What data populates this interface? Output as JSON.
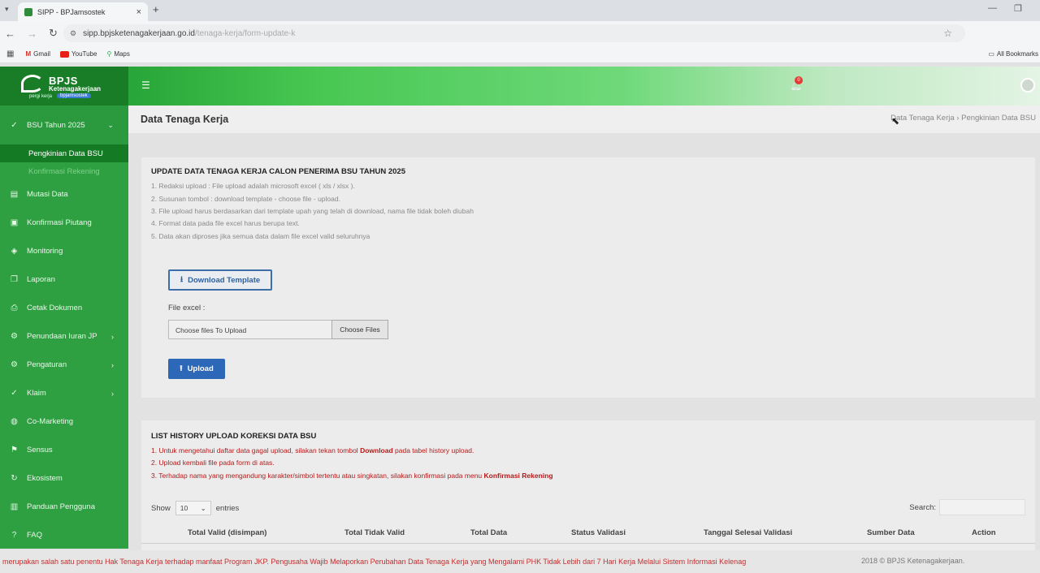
{
  "browser": {
    "tab_title": "SIPP - BPJamsostek",
    "url": "sipp.bpjsketenagakerjaan.go.id",
    "url_dim": "/tenaga-kerja/form-update-k",
    "bookmarks": [
      "Gmail",
      "YouTube",
      "Maps"
    ],
    "all_bookmarks": "All Bookmarks"
  },
  "brand": {
    "name": "BPJS",
    "sub": "Ketenagakerjaan",
    "tag_prefix": "pergi kerja",
    "tag": "bpjamsostek"
  },
  "header": {
    "notification_count": "0"
  },
  "sidebar": {
    "group": "BSU Tahun 2025",
    "sub_items": [
      "Pengkinian Data BSU",
      "Konfirmasi Rekening"
    ],
    "items": [
      {
        "label": "Mutasi Data",
        "icon": "document-icon",
        "glyph": "▤",
        "arrow": ""
      },
      {
        "label": "Konfirmasi Piutang",
        "icon": "wallet-icon",
        "glyph": "▣",
        "arrow": ""
      },
      {
        "label": "Monitoring",
        "icon": "layers-icon",
        "glyph": "◈",
        "arrow": ""
      },
      {
        "label": "Laporan",
        "icon": "copy-icon",
        "glyph": "❐",
        "arrow": ""
      },
      {
        "label": "Cetak Dokumen",
        "icon": "printer-icon",
        "glyph": "⎙",
        "arrow": ""
      },
      {
        "label": "Penundaan Iuran JP",
        "icon": "settings-icon",
        "glyph": "⚙",
        "arrow": "›"
      },
      {
        "label": "Pengaturan",
        "icon": "settings-icon",
        "glyph": "⚙",
        "arrow": "›"
      },
      {
        "label": "Klaim",
        "icon": "check-circle-icon",
        "glyph": "✓",
        "arrow": "›"
      },
      {
        "label": "Co-Marketing",
        "icon": "globe-icon",
        "glyph": "◍",
        "arrow": ""
      },
      {
        "label": "Sensus",
        "icon": "bookmark-icon",
        "glyph": "⚑",
        "arrow": ""
      },
      {
        "label": "Ekosistem",
        "icon": "refresh-icon",
        "glyph": "↻",
        "arrow": ""
      },
      {
        "label": "Panduan Pengguna",
        "icon": "book-icon",
        "glyph": "▥",
        "arrow": ""
      },
      {
        "label": "FAQ",
        "icon": "help-icon",
        "glyph": "?",
        "arrow": ""
      }
    ]
  },
  "page": {
    "title": "Data Tenaga Kerja",
    "breadcrumb": [
      "Data Tenaga Kerja",
      "Pengkinian Data BSU"
    ]
  },
  "upload_card": {
    "title": "UPDATE DATA TENAGA KERJA CALON PENERIMA BSU TAHUN 2025",
    "rules": [
      "1. Redaksi upload : File upload adalah microsoft excel ( xls / xlsx ).",
      "2. Susunan tombol : download template - choose file - upload.",
      "3. File upload harus berdasarkan dari template upah yang telah di download, nama file tidak boleh diubah",
      "4. Format data pada file excel harus berupa text.",
      "5. Data akan diproses jika semua data dalam file excel valid seluruhnya"
    ],
    "download_label": "Download Template",
    "file_label": "File excel :",
    "file_placeholder": "Choose files To Upload",
    "choose_label": "Choose Files",
    "upload_label": "Upload"
  },
  "history_card": {
    "title": "LIST HISTORY UPLOAD KOREKSI DATA BSU",
    "note1_a": "1. Untuk mengetahui daftar data gagal upload, silakan tekan tombol ",
    "note1_b": "Download",
    "note1_c": " pada tabel history upload.",
    "note2": "2. Upload kembali file pada form di atas.",
    "note3_a": "3. Terhadap nama yang mengandung karakter/simbol tertentu atau singkatan, silakan konfirmasi pada menu ",
    "note3_b": "Konfirmasi Rekening",
    "show": "Show",
    "entries_value": "10",
    "entries": "entries",
    "search": "Search:",
    "columns": [
      "Total Valid (disimpan)",
      "Total Tidak Valid",
      "Total Data",
      "Status Validasi",
      "Tanggal Selesai Validasi",
      "Sumber Data",
      "Action"
    ]
  },
  "footer": {
    "marquee": "merupakan salah satu penentu Hak Tenaga Kerja terhadap manfaat Program JKP. Pengusaha Wajib Melaporkan Perubahan Data Tenaga Kerja yang Mengalami PHK Tidak Lebih dari 7 Hari Kerja Melalui Sistem Informasi Kelenag",
    "copyright": "2018 © BPJS Ketenagakerjaan."
  },
  "colors": {
    "brand_green": "#2fa042",
    "primary_blue": "#2c67b8",
    "alert_red": "#b51a1a"
  }
}
